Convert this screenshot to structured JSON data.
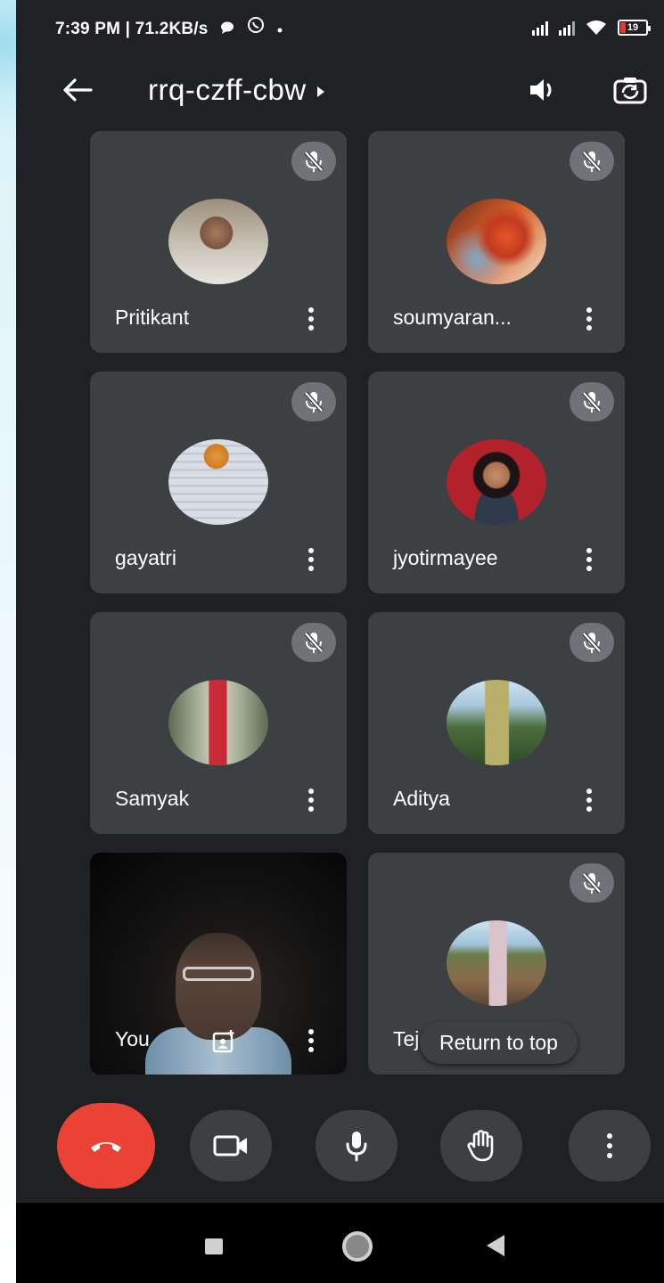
{
  "status_bar": {
    "time_and_speed": "7:39 PM | 71.2KB/s",
    "battery_level": "19",
    "icons": [
      "chat-bubble-icon",
      "whatsapp-icon",
      "dot-icon",
      "signal-icon",
      "signal-icon",
      "wifi-icon",
      "battery-icon"
    ]
  },
  "header": {
    "meeting_code": "rrq-czff-cbw",
    "icons": [
      "back-arrow-icon",
      "caret-right-icon",
      "speaker-icon",
      "switch-camera-icon"
    ]
  },
  "participants": [
    {
      "name": "Pritikant",
      "muted": true
    },
    {
      "name": "soumyaran...",
      "muted": true
    },
    {
      "name": "gayatri",
      "muted": true
    },
    {
      "name": "jyotirmayee",
      "muted": true
    },
    {
      "name": "Samyak",
      "muted": true
    },
    {
      "name": "Aditya",
      "muted": true
    },
    {
      "name": "You",
      "muted": false
    },
    {
      "name": "Tej",
      "muted": true
    }
  ],
  "return_to_top_label": "Return to top",
  "controls": [
    "end-call-icon",
    "camera-icon",
    "microphone-icon",
    "raise-hand-icon",
    "more-vert-icon"
  ],
  "colors": {
    "background": "#202124",
    "tile": "#3c4043",
    "end_call": "#ea4335",
    "battery_low": "#e53935"
  }
}
